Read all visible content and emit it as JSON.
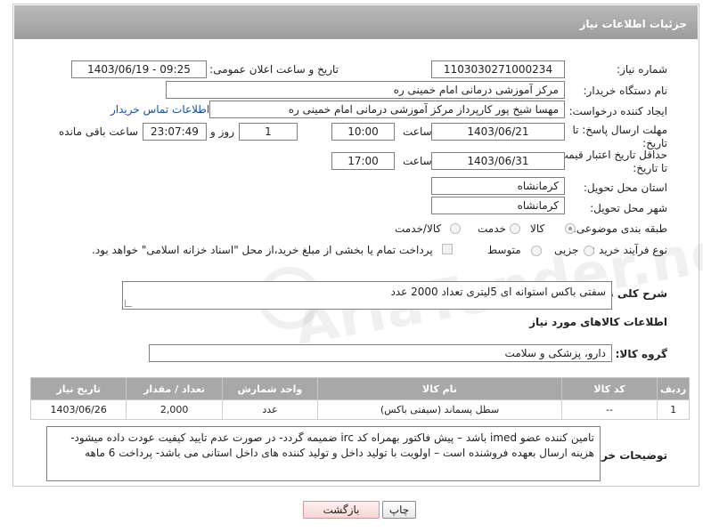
{
  "header": {
    "title": "جزئیات اطلاعات نیاز"
  },
  "fields": {
    "need_number": {
      "label": "شماره نیاز:",
      "value": "1103030271000234"
    },
    "announce_datetime": {
      "label": "تاریخ و ساعت اعلان عمومی:",
      "value": "1403/06/19 - 09:25"
    },
    "buyer_org": {
      "label": "نام دستگاه خریدار:",
      "value": "مرکز آموزشی درمانی امام خمینی ره"
    },
    "requester": {
      "label": "ایجاد کننده درخواست:",
      "value": "مهسا شیخ پور کارپرداز مرکز آموزشی درمانی امام خمینی ره"
    },
    "contact_link": "اطلاعات تماس خریدار",
    "reply_deadline": {
      "label": "مهلت ارسال پاسخ: تا تاریخ:",
      "date": "1403/06/21",
      "time_label": "ساعت",
      "time": "10:00",
      "days": "1",
      "days_label": "روز و",
      "remaining": "23:07:49",
      "remaining_label": "ساعت باقی مانده"
    },
    "price_validity": {
      "label": "حداقل تاریخ اعتبار قیمت: تا تاریخ:",
      "date": "1403/06/31",
      "time_label": "ساعت",
      "time": "17:00"
    },
    "province": {
      "label": "استان محل تحویل:",
      "value": "کرمانشاه"
    },
    "city": {
      "label": "شهر محل تحویل:",
      "value": "کرمانشاه"
    },
    "category": {
      "label": "طبقه بندی موضوعی:",
      "options": [
        "کالا",
        "خدمت",
        "کالا/خدمت"
      ],
      "selected": "کالا"
    },
    "purchase_type": {
      "label": "نوع فرآیند خرید :",
      "options": [
        "جزیی",
        "متوسط"
      ],
      "selected": "جزیی",
      "payment_note": "پرداخت تمام یا بخشی از مبلغ خرید،از محل \"اسناد خزانه اسلامی\" خواهد بود."
    }
  },
  "summary": {
    "label": "شرح کلی نیاز:",
    "value": "سفتی باکس استوانه ای 5لیتری تعداد 2000 عدد"
  },
  "goods_section_title": "اطلاعات کالاهای مورد نیاز",
  "goods_group": {
    "label": "گروه کالا:",
    "value": "دارو، پزشکی و سلامت"
  },
  "table": {
    "columns": [
      "ردیف",
      "کد کالا",
      "نام کالا",
      "واحد شمارش",
      "تعداد / مقدار",
      "تاریخ نیاز"
    ],
    "rows": [
      [
        "1",
        "--",
        "سطل پسماند (سیفتی باکس)",
        "عدد",
        "2,000",
        "1403/06/26"
      ]
    ]
  },
  "buyer_notes": {
    "label": "توضیحات خریدار:",
    "value": "تامین کننده عضو imed باشد – پیش فاکتور بهمراه کد irc ضمیمه گردد- در صورت عدم تایید کیفیت عودت داده میشود- هزینه ارسال بعهده فروشنده است – اولویت با تولید داخل و تولید کننده های داخل استانی می باشد- پرداخت 6 ماهه"
  },
  "buttons": {
    "print": "چاپ",
    "back": "بازگشت"
  },
  "watermark": {
    "text": "AriaTender.neT"
  }
}
